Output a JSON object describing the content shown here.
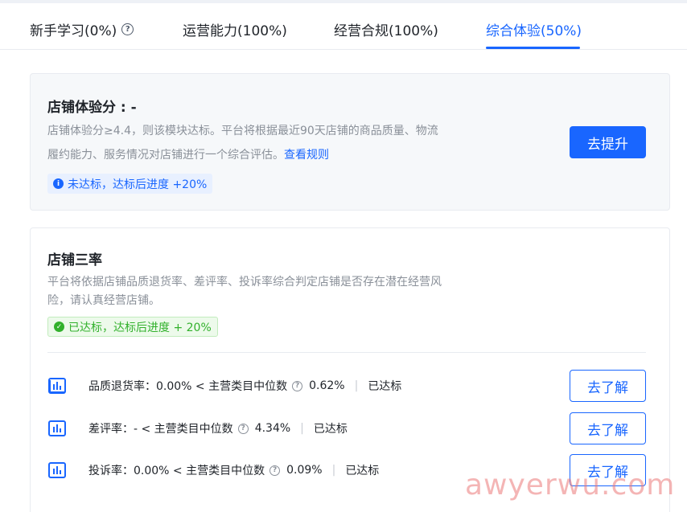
{
  "tabs": [
    {
      "label": "新手学习(0%)"
    },
    {
      "label": "运营能力(100%)"
    },
    {
      "label": "经营合规(100%)"
    },
    {
      "label": "综合体验(50%)"
    }
  ],
  "experience": {
    "title": "店铺体验分 : -",
    "desc_line1": "店铺体验分≥4.4，则该模块达标。平台将根据最近90天店铺的商品质量、物流",
    "desc_line2": "履约能力、服务情况对店铺进行一个综合评估。",
    "rule_link": "查看规则",
    "badge": "未达标，达标后进度 +20%",
    "button": "去提升"
  },
  "three_rates": {
    "title": "店铺三率",
    "desc_line1": "平台将依据店铺品质退货率、差评率、投诉率综合判定店铺是否存在潜在经营风",
    "desc_line2": "险，请认真经营店铺。",
    "badge": "已达标，达标后进度 + 20%",
    "rows": [
      {
        "label": "品质退货率：0.00% < 主营类目中位数",
        "median": "0.62%",
        "status": "已达标",
        "button": "去了解"
      },
      {
        "label": "差评率：- < 主营类目中位数",
        "median": "4.34%",
        "status": "已达标",
        "button": "去了解"
      },
      {
        "label": "投诉率：0.00% < 主营类目中位数",
        "median": "0.09%",
        "status": "已达标",
        "button": "去了解"
      }
    ]
  },
  "watermark": "awyerwu.com",
  "colors": {
    "accent": "#1966ff",
    "success": "#32b12c"
  }
}
